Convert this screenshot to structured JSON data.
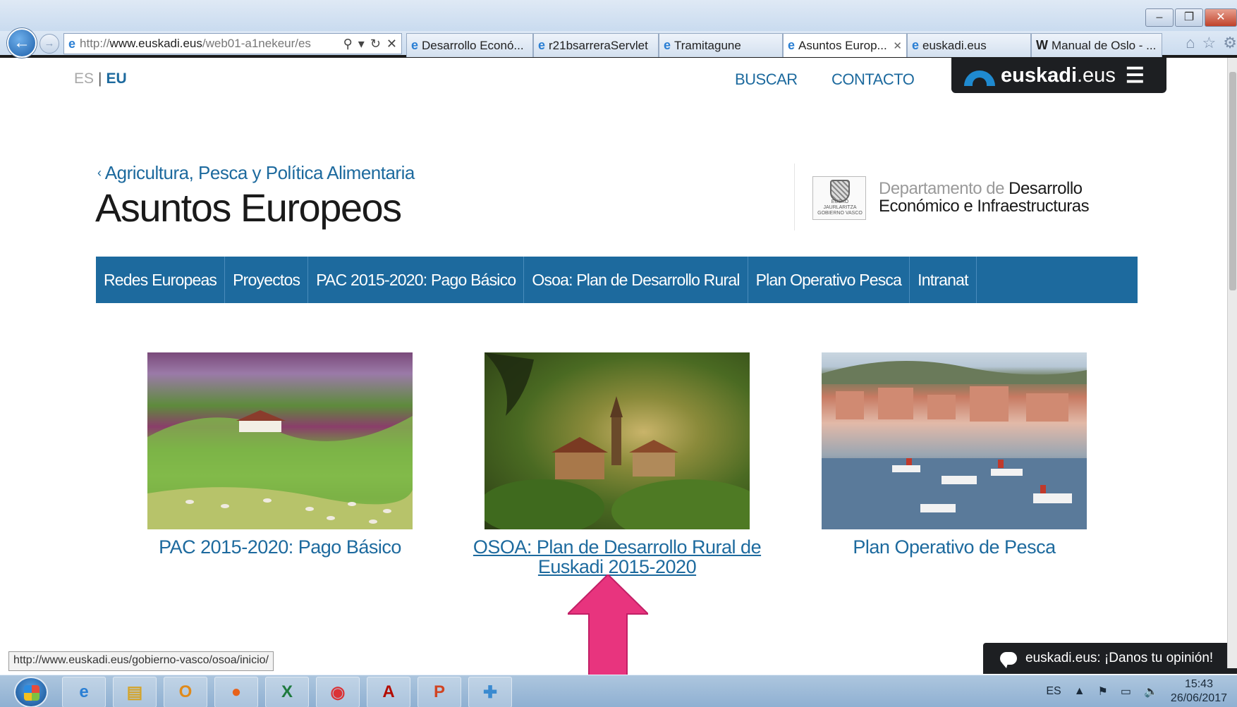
{
  "browser": {
    "address": {
      "prefix": "http://",
      "domain": "www.euskadi.eus",
      "path": "/web01-a1nekeur/es"
    },
    "tabs": [
      {
        "label": "Desarrollo Econó..."
      },
      {
        "label": "r21bsarreraServlet"
      },
      {
        "label": "Tramitagune"
      },
      {
        "label": "Asuntos Europ...",
        "active": true
      },
      {
        "label": "euskadi.eus"
      },
      {
        "label": "Manual de Oslo - ..."
      }
    ],
    "status_url": "http://www.euskadi.eus/gobierno-vasco/osoa/inicio/"
  },
  "header": {
    "lang_es": "ES",
    "lang_sep": "|",
    "lang_eu": "EU",
    "buscar": "BUSCAR",
    "contacto": "CONTACTO",
    "brand_name": "euskadi",
    "brand_suffix": ".eus"
  },
  "section": {
    "breadcrumb": "Agricultura, Pesca y Política Alimentaria",
    "title": "Asuntos Europeos",
    "dept_light": "Departamento de",
    "dept_dark_1": "Desarrollo",
    "dept_dark_2": "Económico e Infraestructuras",
    "seal_text": "EUSKO JAURLARITZA GOBIERNO VASCO"
  },
  "mainnav": [
    "Redes Europeas",
    "Proyectos",
    "PAC 2015-2020: Pago Básico",
    "Osoa: Plan de Desarrollo Rural",
    "Plan Operativo Pesca",
    "Intranat"
  ],
  "cards": [
    {
      "caption": "PAC 2015-2020: Pago Básico"
    },
    {
      "caption_1": "OSOA: Plan de Desarrollo Rural de",
      "caption_2": "Euskadi 2015-2020"
    },
    {
      "caption": "Plan Operativo de Pesca"
    }
  ],
  "feedback": "euskadi.eus: ¡Danos tu opinión!",
  "taskbar": {
    "lang": "ES",
    "time": "15:43",
    "date": "26/06/2017"
  },
  "colors": {
    "brand_blue": "#1d6a9e",
    "annotation_arrow": "#e8347e"
  }
}
